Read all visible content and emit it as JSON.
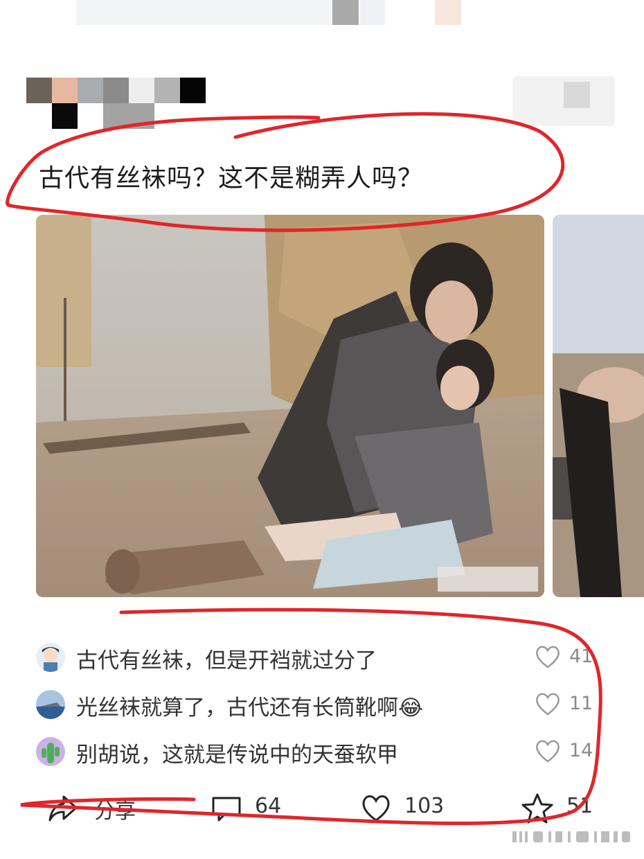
{
  "post": {
    "title": "古代有丝袜吗？这不是糊弄人吗？"
  },
  "comments": [
    {
      "text": "古代有丝袜，但是开裆就过分了",
      "likes": "41"
    },
    {
      "text": "光丝袜就算了，古代还有长筒靴啊😂",
      "likes": "11"
    },
    {
      "text": "别胡说，这就是传说中的天蚕软甲",
      "likes": "14"
    }
  ],
  "actions": {
    "share_label": "分享",
    "comment_count": "64",
    "like_count": "103",
    "star_count": "51"
  },
  "colors": {
    "annotation_red": "#e0262a",
    "text": "#333333",
    "muted": "#8a8a8a"
  },
  "icons": [
    "heart-icon",
    "share-icon",
    "comment-icon",
    "star-icon"
  ]
}
